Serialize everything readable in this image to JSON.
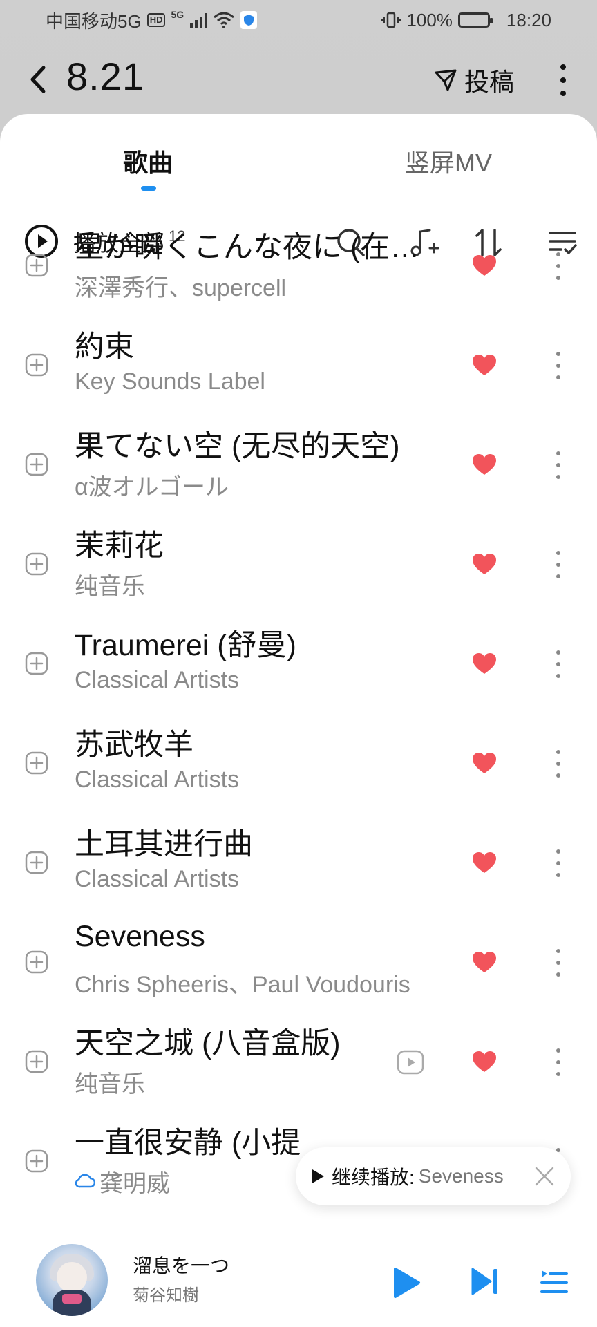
{
  "status_bar": {
    "carrier": "中国移动5G",
    "hd_badge": "HD",
    "signal_label": "5G",
    "battery": "100%",
    "time": "18:20"
  },
  "header": {
    "title": "8.21",
    "submit_label": "投稿"
  },
  "tabs": [
    {
      "label": "歌曲",
      "active": true
    },
    {
      "label": "竖屏MV",
      "active": false
    }
  ],
  "toolbar": {
    "play_all_label": "播放全部",
    "count": "12"
  },
  "songs": [
    {
      "title": "星が瞬くこんな夜に (在…",
      "artist": "深澤秀行、supercell",
      "liked": true
    },
    {
      "title": "約束",
      "artist": "Key Sounds Label",
      "liked": true
    },
    {
      "title": "果てない空 (无尽的天空)",
      "artist": "α波オルゴール",
      "liked": true
    },
    {
      "title": "茉莉花",
      "artist": "纯音乐",
      "liked": true
    },
    {
      "title": "Traumerei (舒曼)",
      "artist": "Classical Artists",
      "liked": true
    },
    {
      "title": "苏武牧羊",
      "artist": "Classical Artists",
      "liked": true
    },
    {
      "title": "土耳其进行曲",
      "artist": "Classical Artists",
      "liked": true
    },
    {
      "title": "Seveness",
      "artist": "Chris Spheeris、Paul Voudouris",
      "liked": true
    },
    {
      "title": "天空之城 (八音盒版)",
      "artist": "纯音乐",
      "liked": true,
      "has_mv": true
    },
    {
      "title": "一直很安静 (小提",
      "artist": "龚明威",
      "liked": true
    }
  ],
  "resume_toast": {
    "label": "继续播放:",
    "song": "Seveness"
  },
  "mini_player": {
    "title": "溜息を一つ",
    "artist": "菊谷知樹"
  },
  "colors": {
    "accent": "#1e8ff0",
    "heart": "#f2545b"
  }
}
